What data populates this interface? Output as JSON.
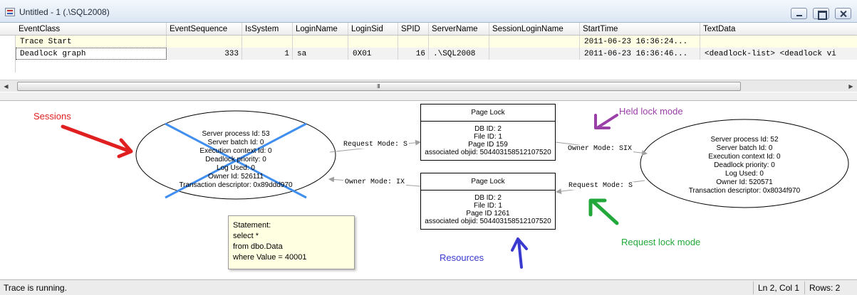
{
  "window": {
    "title": "Untitled - 1 (.\\SQL2008)"
  },
  "grid": {
    "columns": [
      "EventClass",
      "EventSequence",
      "IsSystem",
      "LoginName",
      "LoginSid",
      "SPID",
      "ServerName",
      "SessionLoginName",
      "StartTime",
      "TextData"
    ],
    "rows": [
      [
        "Trace Start",
        "",
        "",
        "",
        "",
        "",
        "",
        "",
        "2011-06-23 16:36:24...",
        ""
      ],
      [
        "Deadlock graph",
        "333",
        "1",
        "sa",
        "0X01",
        "16",
        ".\\SQL2008",
        "",
        "2011-06-23 16:36:46...",
        "<deadlock-list>   <deadlock vi"
      ]
    ]
  },
  "scrollbar": {
    "left_arrow": "◀",
    "right_arrow": "▶",
    "grip": "III"
  },
  "graph": {
    "process_left": {
      "lines": [
        "Server process Id: 53",
        "Server batch Id: 0",
        "Execution context Id: 0",
        "Deadlock priority: 0",
        "Log Used: 0",
        "Owner Id: 526111",
        "Transaction descriptor: 0x89ddd970"
      ],
      "victim": true
    },
    "process_right": {
      "lines": [
        "Server process Id: 52",
        "Server batch Id: 0",
        "Execution context Id: 0",
        "Deadlock priority: 0",
        "Log Used: 0",
        "Owner Id: 520571",
        "Transaction descriptor: 0x8034f970"
      ]
    },
    "resource_top": {
      "title": "Page Lock",
      "lines": [
        "DB ID: 2",
        "File ID: 1",
        "Page ID 159",
        "associated objid: 504403158512107520"
      ]
    },
    "resource_bottom": {
      "title": "Page Lock",
      "lines": [
        "DB ID: 2",
        "File ID: 1",
        "Page ID 1261",
        "associated objid: 504403158512107520"
      ]
    },
    "edges": {
      "request_left": "Request Mode: S",
      "owner_left": "Owner Mode: IX",
      "owner_right": "Owner Mode: SIX",
      "request_right": "Request Mode: S"
    },
    "statement": [
      "Statement:",
      "select *",
      "from  dbo.Data",
      "where Value = 40001"
    ]
  },
  "annotations": {
    "sessions": "Sessions",
    "held": "Held lock mode",
    "request": "Request lock mode",
    "resources": "Resources",
    "colors": {
      "sessions": "#e02020",
      "held": "#9b3fa8",
      "request": "#22a83a",
      "resources": "#3a3ad0",
      "victim": "#3f8ef0"
    }
  },
  "status": {
    "text": "Trace is running.",
    "position": "Ln 2, Col 1",
    "rows": "Rows: 2"
  }
}
